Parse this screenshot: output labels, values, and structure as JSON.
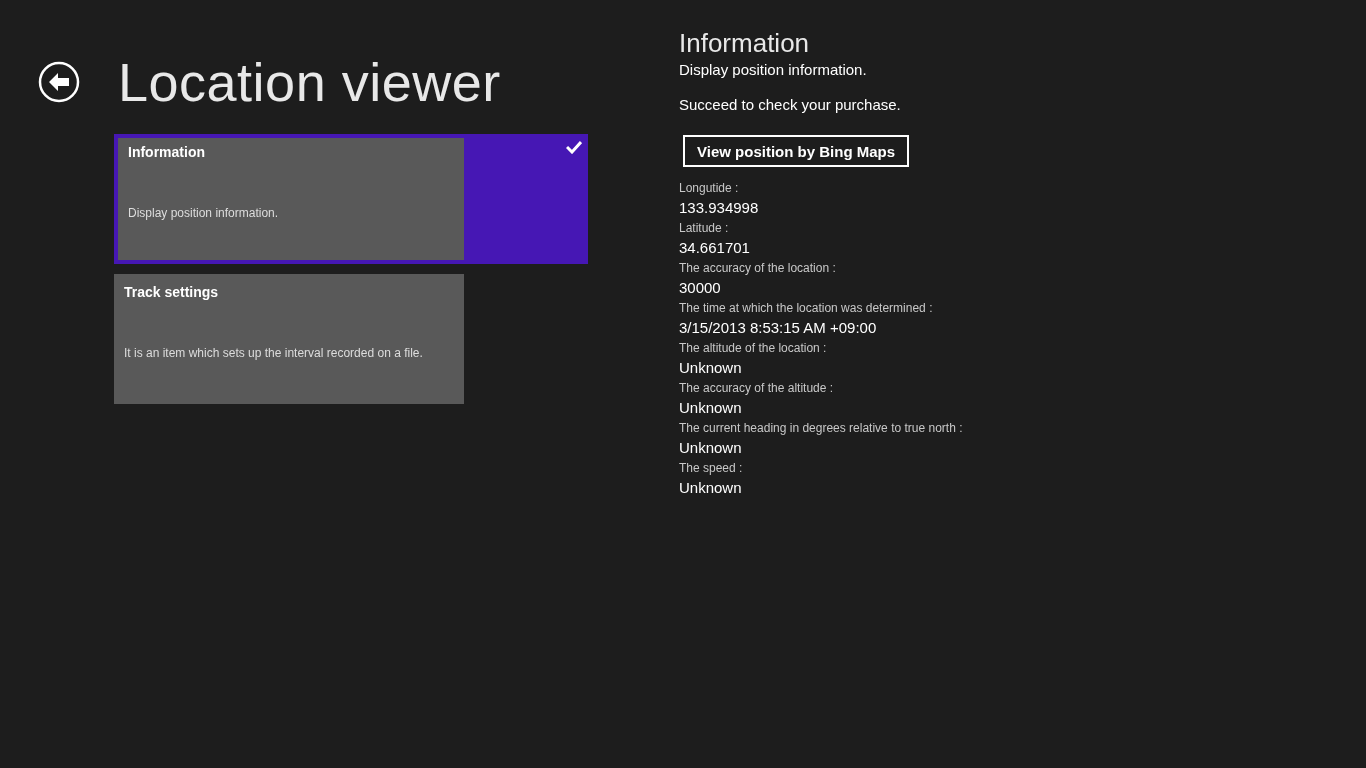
{
  "page": {
    "title": "Location viewer"
  },
  "items": [
    {
      "title": "Information",
      "description": "Display position information.",
      "selected": true
    },
    {
      "title": "Track settings",
      "description": "It is an item which sets up the interval recorded on a file.",
      "selected": false
    }
  ],
  "detail": {
    "title": "Information",
    "subtitle": "Display position information.",
    "status": "Succeed to check your purchase.",
    "button": "View position by Bing Maps",
    "fields": [
      {
        "label": "Longutide :",
        "value": "133.934998"
      },
      {
        "label": "Latitude :",
        "value": "34.661701"
      },
      {
        "label": "The accuracy of the location :",
        "value": "30000"
      },
      {
        "label": "The time at which the location was determined :",
        "value": "3/15/2013 8:53:15 AM +09:00"
      },
      {
        "label": "The altitude of the location :",
        "value": "Unknown"
      },
      {
        "label": "The accuracy of the altitude :",
        "value": "Unknown"
      },
      {
        "label": "The current heading in degrees relative to true north :",
        "value": "Unknown"
      },
      {
        "label": "The speed :",
        "value": "Unknown"
      }
    ]
  }
}
